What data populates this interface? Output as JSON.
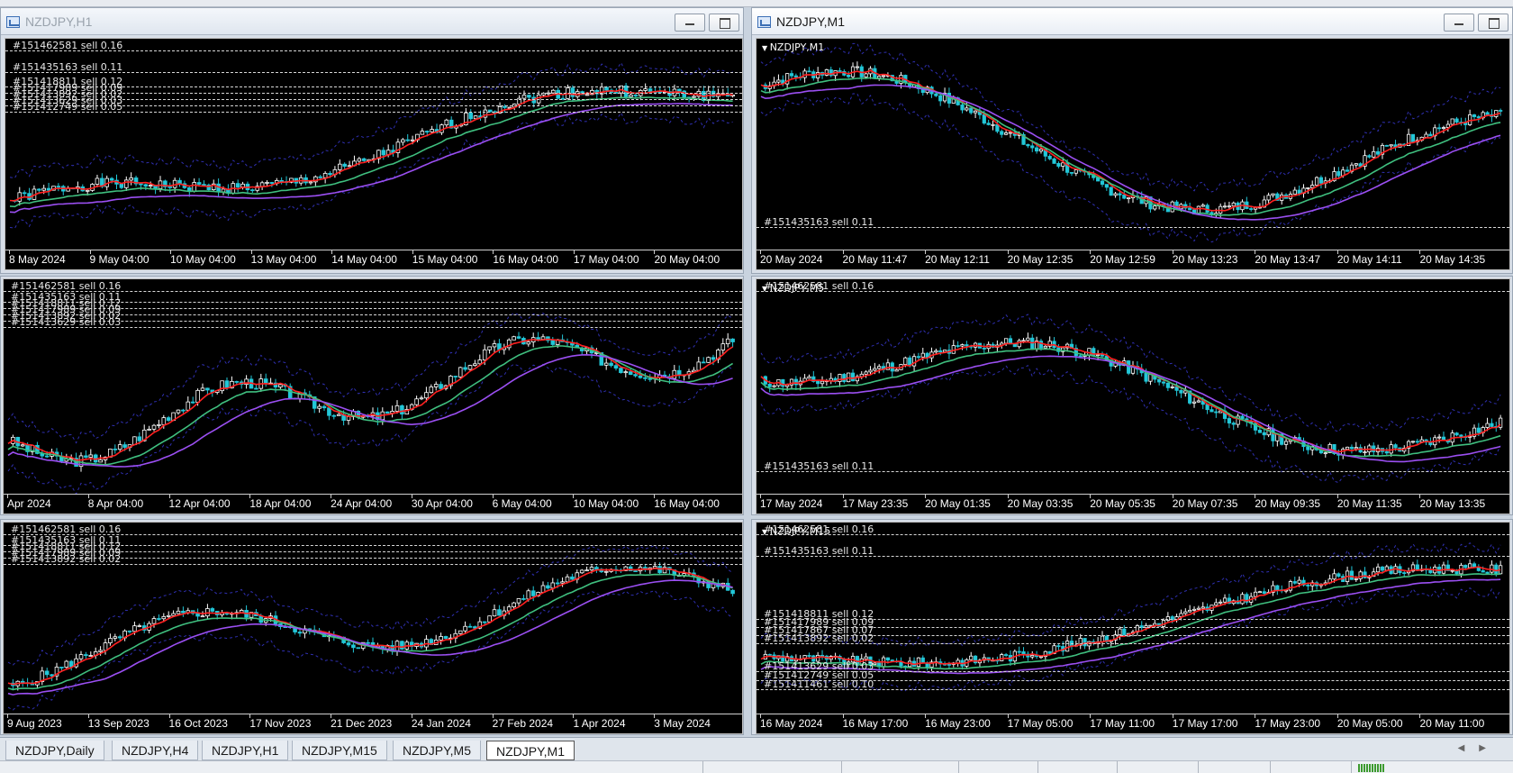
{
  "windows": [
    {
      "id": "h1",
      "title": "NZDJPY,H1",
      "active": false,
      "chart_label": "",
      "orders": [
        {
          "text": "#151462581 sell 0.16",
          "pos": "top"
        },
        {
          "text": "#151435163 sell 0.11",
          "pos": "upper"
        },
        {
          "text": "#151418811 sell 0.12",
          "pos": "cluster"
        },
        {
          "text": "#151417989 sell 0.09",
          "pos": "cluster"
        },
        {
          "text": "#151413892 sell 0.02",
          "pos": "cluster"
        },
        {
          "text": "#151413629 sell 0.03",
          "pos": "cluster"
        },
        {
          "text": "#151412749 sell 0.05",
          "pos": "cluster"
        }
      ],
      "ticks": [
        "8 May 2024",
        "9 May 04:00",
        "10 May 04:00",
        "13 May 04:00",
        "14 May 04:00",
        "15 May 04:00",
        "16 May 04:00",
        "17 May 04:00",
        "20 May 04:00"
      ]
    },
    {
      "id": "m1",
      "title": "NZDJPY,M1",
      "active": true,
      "chart_label": "NZDJPY,M1",
      "orders": [
        {
          "text": "#151435163 sell 0.11",
          "pos": "bottom"
        }
      ],
      "ticks": [
        "20 May 2024",
        "20 May 11:47",
        "20 May 12:11",
        "20 May 12:35",
        "20 May 12:59",
        "20 May 13:23",
        "20 May 13:47",
        "20 May 14:11",
        "20 May 14:35"
      ]
    },
    {
      "id": "h4",
      "title": "",
      "active": false,
      "chart_label": "",
      "orders": [
        {
          "text": "#151462581 sell 0.16",
          "pos": "top"
        },
        {
          "text": "#151435163 sell 0.11",
          "pos": "cluster"
        },
        {
          "text": "#151418811 sell 0.12",
          "pos": "cluster"
        },
        {
          "text": "#151417989 sell 0.09",
          "pos": "cluster"
        },
        {
          "text": "#151413892 sell 0.02",
          "pos": "cluster"
        },
        {
          "text": "#151413629 sell 0.03",
          "pos": "cluster"
        }
      ],
      "ticks": [
        "Apr 2024",
        "8 Apr 04:00",
        "12 Apr 04:00",
        "18 Apr 04:00",
        "24 Apr 04:00",
        "30 Apr 04:00",
        "6 May 04:00",
        "10 May 04:00",
        "16 May 04:00"
      ]
    },
    {
      "id": "m5",
      "title": "",
      "active": false,
      "chart_label": "NZDJPY,M5",
      "orders": [
        {
          "text": "#151462581 sell 0.16",
          "pos": "top"
        },
        {
          "text": "#151435163 sell 0.11",
          "pos": "bottom"
        }
      ],
      "ticks": [
        "17 May 2024",
        "17 May 23:35",
        "20 May 01:35",
        "20 May 03:35",
        "20 May 05:35",
        "20 May 07:35",
        "20 May 09:35",
        "20 May 11:35",
        "20 May 13:35"
      ]
    },
    {
      "id": "daily",
      "title": "",
      "active": false,
      "chart_label": "",
      "orders": [
        {
          "text": "#151462581 sell 0.16",
          "pos": "top"
        },
        {
          "text": "#151435163 sell 0.11",
          "pos": "cluster"
        },
        {
          "text": "#151418811 sell 0.12",
          "pos": "cluster"
        },
        {
          "text": "#151417989 sell 0.09",
          "pos": "cluster"
        },
        {
          "text": "#151413892 sell 0.02",
          "pos": "cluster"
        }
      ],
      "ticks": [
        "9 Aug 2023",
        "13 Sep 2023",
        "16 Oct 2023",
        "17 Nov 2023",
        "21 Dec 2023",
        "24 Jan 2024",
        "27 Feb 2024",
        "1 Apr 2024",
        "3 May 2024"
      ]
    },
    {
      "id": "m15",
      "title": "",
      "active": false,
      "chart_label": "NZDJPY,M15",
      "orders": [
        {
          "text": "#151462581 sell 0.16",
          "pos": "top"
        },
        {
          "text": "#151435163 sell 0.11",
          "pos": "upper"
        },
        {
          "text": "#151418811 sell 0.12",
          "pos": "mid"
        },
        {
          "text": "#151417989 sell 0.09",
          "pos": "mid"
        },
        {
          "text": "#151417867 sell 0.07",
          "pos": "mid"
        },
        {
          "text": "#151413892 sell 0.02",
          "pos": "mid"
        },
        {
          "text": "#151413629 sell 0.03",
          "pos": "low"
        },
        {
          "text": "#151412749 sell 0.05",
          "pos": "low"
        },
        {
          "text": "#151411461 sell 0.10",
          "pos": "low"
        }
      ],
      "ticks": [
        "16 May 2024",
        "16 May 17:00",
        "16 May 23:00",
        "17 May 05:00",
        "17 May 11:00",
        "17 May 17:00",
        "17 May 23:00",
        "20 May 05:00",
        "20 May 11:00"
      ]
    }
  ],
  "tabs": [
    "NZDJPY,Daily",
    "NZDJPY,H4",
    "NZDJPY,H1",
    "NZDJPY,M15",
    "NZDJPY,M5",
    "NZDJPY,M1"
  ],
  "active_tab": "NZDJPY,M1",
  "colors": {
    "bull": "#ffffff",
    "bear": "#22c7d8",
    "ma_fast": "#ff2020",
    "ma_mid": "#3fbf7f",
    "ma_slow": "#9b4ff2",
    "envelope": "#2f2fb0",
    "chart_bg": "#000000"
  }
}
